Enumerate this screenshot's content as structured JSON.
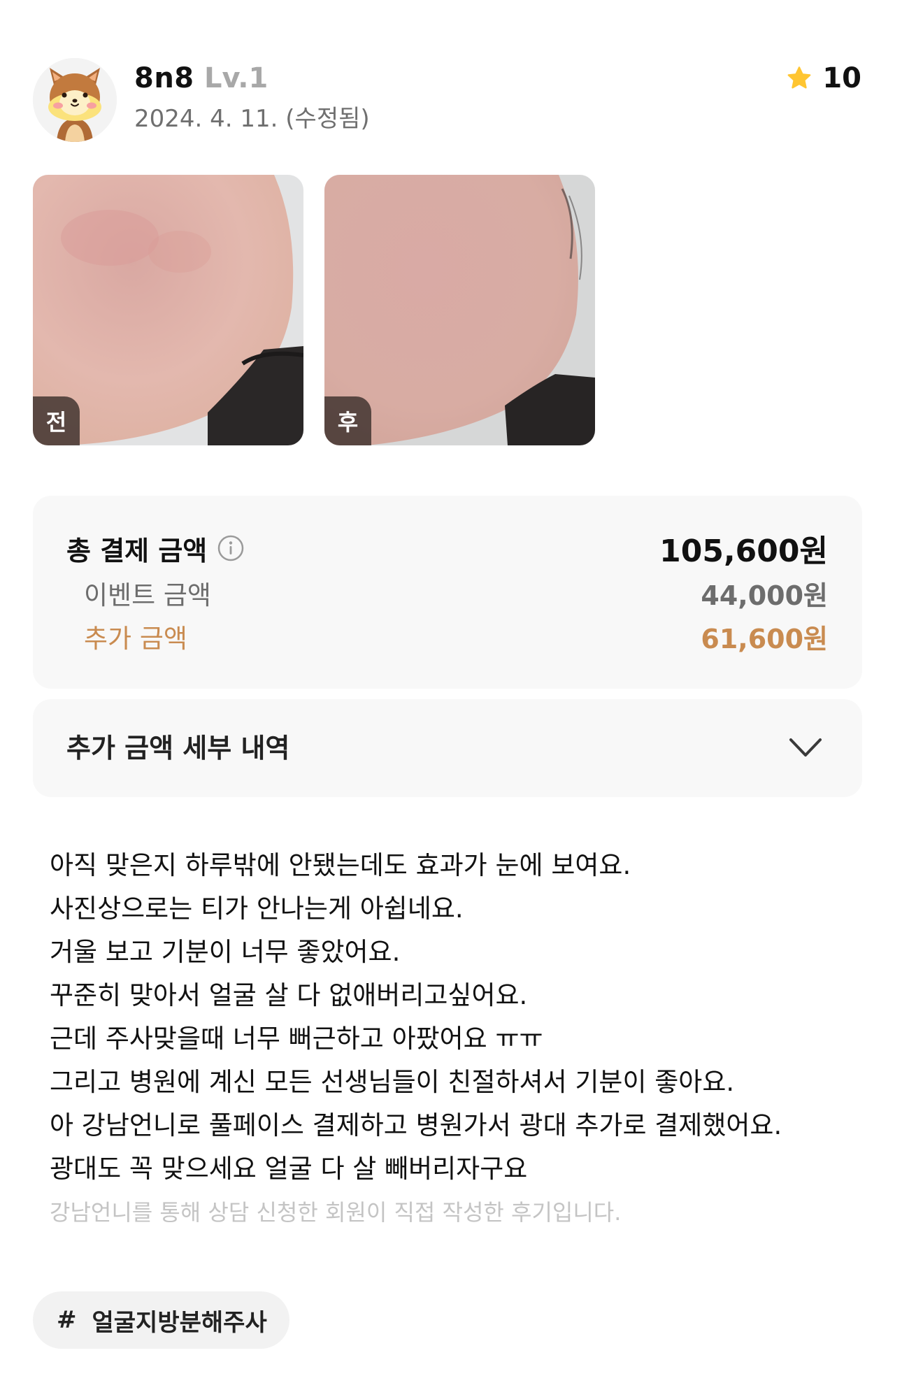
{
  "header": {
    "username": "8n8",
    "level": "Lv.1",
    "date": "2024. 4. 11. (수정됨)",
    "rating": "10",
    "star_icon": "star-icon",
    "star_color": "#ffc531"
  },
  "photos": [
    {
      "tag": "전",
      "alt": "before-photo"
    },
    {
      "tag": "후",
      "alt": "after-photo"
    }
  ],
  "price": {
    "total_label": "총 결제 금액",
    "total_value": "105,600원",
    "event_label": "이벤트 금액",
    "event_value": "44,000원",
    "extra_label": "추가 금액",
    "extra_value": "61,600원",
    "accent_color": "#c98b50"
  },
  "accordion": {
    "title": "추가 금액 세부 내역"
  },
  "review": {
    "lines": [
      "아직 맞은지 하루밖에 안됐는데도 효과가 눈에 보여요.",
      "사진상으로는 티가 안나는게 아쉽네요.",
      "거울 보고 기분이 너무 좋았어요.",
      "꾸준히 맞아서 얼굴 살 다 없애버리고싶어요.",
      "근데 주사맞을때 너무 뻐근하고 아팠어요 ㅠㅠ",
      "그리고 병원에 계신 모든 선생님들이 친절하셔서 기분이 좋아요.",
      "아 강남언니로 풀페이스 결제하고 병원가서 광대 추가로 결제했어요.",
      "광대도 꼭 맞으세요 얼굴 다 살 빼버리자구요"
    ],
    "disclaimer": "강남언니를 통해 상담 신청한 회원이 직접 작성한 후기입니다."
  },
  "hashtag": {
    "symbol": "#",
    "text": "얼굴지방분해주사"
  }
}
